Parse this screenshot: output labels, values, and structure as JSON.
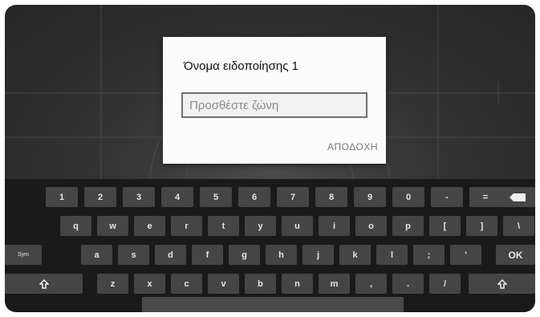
{
  "dialog": {
    "title": "Όνομα ειδοποίησης 1",
    "input_placeholder": "Προσθέστε ζώνη",
    "accept_label": "ΑΠΟΔΟΧΗ"
  },
  "keyboard": {
    "row1": [
      "1",
      "2",
      "3",
      "4",
      "5",
      "6",
      "7",
      "8",
      "9",
      "0",
      "-",
      "="
    ],
    "row2": [
      "q",
      "w",
      "e",
      "r",
      "t",
      "y",
      "u",
      "i",
      "o",
      "p",
      "[",
      "]",
      "\\"
    ],
    "row3": [
      "a",
      "s",
      "d",
      "f",
      "g",
      "h",
      "j",
      "k",
      "l",
      ";",
      "'"
    ],
    "row4": [
      "z",
      "x",
      "c",
      "v",
      "b",
      "n",
      "m",
      ",",
      ".",
      "/"
    ],
    "sym_label": "Sym",
    "ok_label": "OK",
    "backspace_icon": "backspace-icon",
    "shift_icon": "shift-icon"
  },
  "colors": {
    "keyboard_bg": "#1a1a1a",
    "key_bg": "#454545",
    "dialog_bg": "#fbfbfb"
  }
}
